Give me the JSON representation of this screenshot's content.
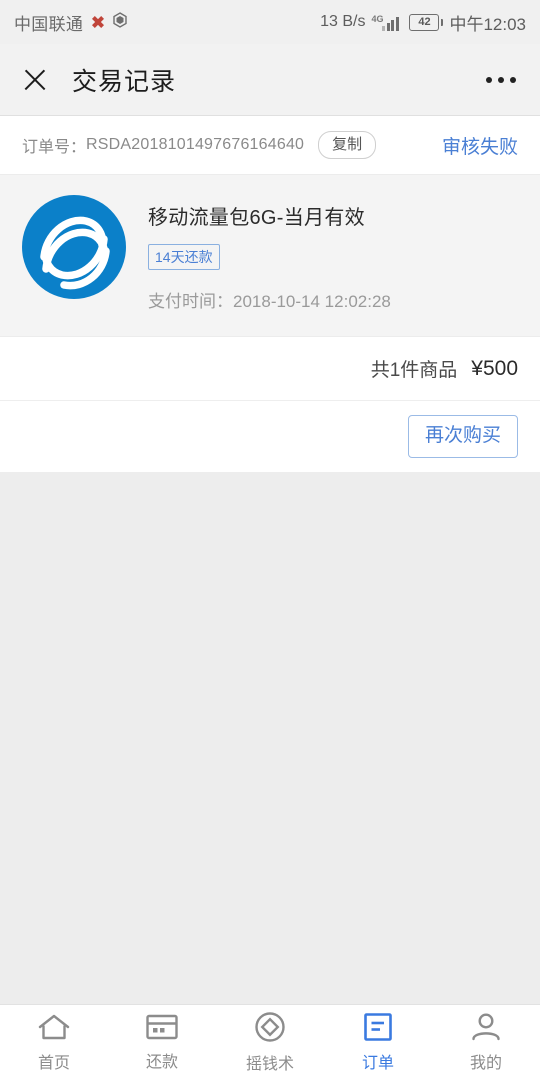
{
  "status_bar": {
    "carrier": "中国联通",
    "network_speed": "13 B/s",
    "network_type": "4G",
    "battery_level": "42",
    "time": "中午12:03",
    "icons": [
      "alert-icon",
      "hexagon-icon",
      "signal-icon",
      "battery-icon"
    ]
  },
  "header": {
    "close_icon": "close-icon",
    "title": "交易记录",
    "more_icon": "more-options-icon"
  },
  "order": {
    "label": "订单号：",
    "number": "RSDA2018101497676164640",
    "copy_label": "复制",
    "status": "审核失败",
    "status_color": "#4a7fd4"
  },
  "product": {
    "logo_name": "china-mobile-logo",
    "logo_color": "#0b80c9",
    "title": "移动流量包6G-当月有效",
    "badge": "14天还款",
    "badge_color": "#4a7fd4",
    "pay_time_label": "支付时间：",
    "pay_time": "2018-10-14 12:02:28"
  },
  "totals": {
    "count_text": "共1件商品",
    "price": "¥500"
  },
  "actions": {
    "buy_again": "再次购买"
  },
  "tabbar": {
    "items": [
      {
        "label": "首页",
        "icon": "home-icon",
        "active": false
      },
      {
        "label": "还款",
        "icon": "card-icon",
        "active": false
      },
      {
        "label": "摇钱术",
        "icon": "diamond-icon",
        "active": false
      },
      {
        "label": "订单",
        "icon": "order-icon",
        "active": true
      },
      {
        "label": "我的",
        "icon": "person-icon",
        "active": false
      }
    ],
    "active_color": "#3a7ae0",
    "inactive_color": "#8c8c8c"
  }
}
